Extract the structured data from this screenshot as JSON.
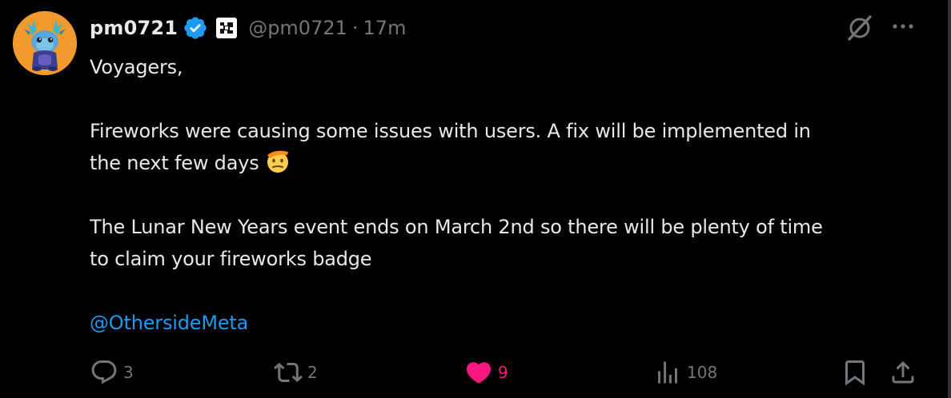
{
  "post": {
    "author": {
      "display_name": "pm0721",
      "handle": "@pm0721",
      "separator": "·",
      "time": "17m",
      "verified": true,
      "avatar_icon": "blue-creature-avatar"
    },
    "text": {
      "line1": "Voyagers,",
      "line2": "Fireworks were causing some issues with users.  A fix will be implemented in",
      "line3": "the next few days",
      "line3_emoji": "saluting-face-emoji",
      "line4": "The Lunar New Years event ends on March 2nd so there will be plenty of time",
      "line5": "to claim your fireworks badge",
      "mention": "@OthersideMeta"
    },
    "actions": {
      "replies": "3",
      "reposts": "2",
      "likes": "9",
      "views": "108",
      "liked": true
    }
  },
  "colors": {
    "background": "#000000",
    "text": "#e7e9ea",
    "muted": "#71767b",
    "link": "#1d9bf0",
    "like": "#f91880",
    "verified": "#1d9bf0",
    "avatar_bg": "#f29a2e"
  }
}
